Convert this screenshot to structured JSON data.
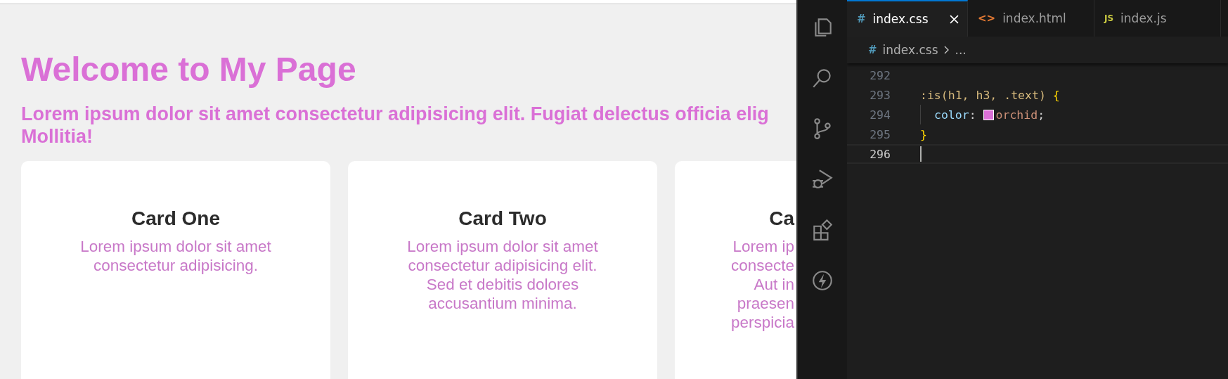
{
  "browser": {
    "heading": "Welcome to My Page",
    "subtitle_lines": [
      "Lorem ipsum dolor sit amet consectetur adipisicing elit. Fugiat delectus officia elig",
      "Mollitia!"
    ],
    "cards": [
      {
        "title": "Card One",
        "lines": [
          "Lorem ipsum dolor sit amet",
          "consectetur adipisicing."
        ]
      },
      {
        "title": "Card Two",
        "lines": [
          "Lorem ipsum dolor sit amet",
          "consectetur adipisicing elit.",
          "Sed et debitis dolores",
          "accusantium minima."
        ]
      },
      {
        "title": "Ca",
        "lines": [
          "Lorem ip",
          "consecte",
          "Aut in",
          "praesen",
          "perspicia"
        ]
      }
    ]
  },
  "editor": {
    "tabs": [
      {
        "label": "index.css",
        "icon": "#",
        "kind": "css",
        "selected": true
      },
      {
        "label": "index.html",
        "icon": "<>",
        "kind": "html",
        "selected": false
      },
      {
        "label": "index.js",
        "icon": "JS",
        "kind": "js",
        "selected": false
      }
    ],
    "breadcrumb": {
      "icon": "#",
      "file": "index.css",
      "rest": "..."
    },
    "lines": [
      {
        "number": "292",
        "current": false
      },
      {
        "number": "293",
        "tokens": [
          {
            "text": ":is(h1, h3, .text) ",
            "kind": "selector"
          },
          {
            "text": "{",
            "kind": "brace"
          }
        ],
        "current": false
      },
      {
        "number": "294",
        "indented": true,
        "tokens": [
          {
            "text": "color",
            "kind": "property"
          },
          {
            "text": ": ",
            "kind": "punct"
          },
          {
            "kind": "swatch",
            "color": "#da70d6"
          },
          {
            "text": "orchid",
            "kind": "value"
          },
          {
            "text": ";",
            "kind": "punct"
          }
        ],
        "current": false
      },
      {
        "number": "295",
        "tokens": [
          {
            "text": "}",
            "kind": "brace"
          }
        ],
        "current": false
      },
      {
        "number": "296",
        "current": true
      }
    ]
  }
}
